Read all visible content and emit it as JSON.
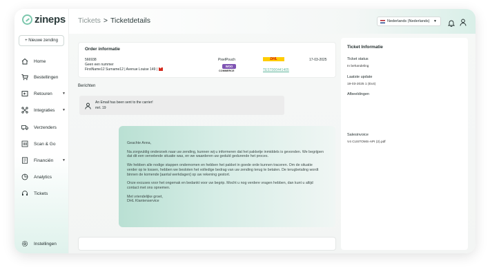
{
  "app": {
    "logo_text": "zineps"
  },
  "sidebar": {
    "new_button": "+ Nieuwe zending",
    "items": [
      {
        "label": "Home",
        "icon": "home-icon"
      },
      {
        "label": "Bestellingen",
        "icon": "cart-icon"
      },
      {
        "label": "Retouren",
        "icon": "return-icon",
        "caret": true
      },
      {
        "label": "Integraties",
        "icon": "integrations-icon",
        "caret": true
      },
      {
        "label": "Verzenders",
        "icon": "truck-icon"
      },
      {
        "label": "Scan & Go",
        "icon": "scan-icon"
      },
      {
        "label": "Financiën",
        "icon": "finance-icon",
        "caret": true
      },
      {
        "label": "Analytics",
        "icon": "analytics-icon"
      },
      {
        "label": "Tickets",
        "icon": "headset-icon"
      }
    ],
    "settings_label": "Instellingen"
  },
  "header": {
    "breadcrumb_parent": "Tickets",
    "breadcrumb_sep": ">",
    "breadcrumb_current": "Ticketdetails",
    "language": "Nederlands (Nederlands)"
  },
  "order": {
    "title": "Order informatie",
    "order_number": "566938",
    "reference": "Geen een nummer",
    "address": "FirstName12 Surname12 | Avenue Louise 149 |",
    "shop": "PixelPouch",
    "platform": "WOO",
    "platform_sub": "COMMERCE",
    "carrier": "DHL",
    "tracking": "TEST000441405",
    "date": "17-03-2025"
  },
  "messages": {
    "label": "Berichten",
    "notice_text": "An Email has been sent to the carrier!",
    "notice_date": "mrt. 19",
    "email": {
      "greeting": "Geachte Anna,",
      "p1": "Na zorgvuldig onderzoek naar uw zending, kunnen wij u informeren dat het pakketje inmiddels is gevonden. We begrijpen dat dit een vervelende situatie was, en we waarderen uw geduld gedurende het proces.",
      "p2": "We hebben alle nodige stappen ondernomen en hebben het pakket in goede orde kunnen traceren. Om de situatie verder op te lossen, hebben we besloten het volledige bedrag van uw zending terug te betalen. De terugbetaling wordt binnen de komende [aantal werkdagen] op uw rekening gestort.",
      "p3": "Onze excuses voor het ongemak en bedankt voor uw begrip. Mocht u nog verdere vragen hebben, dan kunt u altijd contact met ons opnemen.",
      "closing": "Met vriendelijke groet,",
      "signature": "DHL Klantenservice"
    }
  },
  "ticket": {
    "title": "Ticket Informatie",
    "status_label": "Ticket status",
    "status_value": "In behandeling",
    "update_label": "Laatste update",
    "update_value": "19-03-2025 1 (Ex4)",
    "images_label": "Afbeeldingen",
    "invoice_label": "Salesinvoice",
    "invoice_file": "V4 CUSTOMS-API (2).pdf"
  },
  "colors": {
    "accent": "#7cc7ad",
    "email_bg": "#b9e0d3",
    "link": "#5fb59b"
  }
}
